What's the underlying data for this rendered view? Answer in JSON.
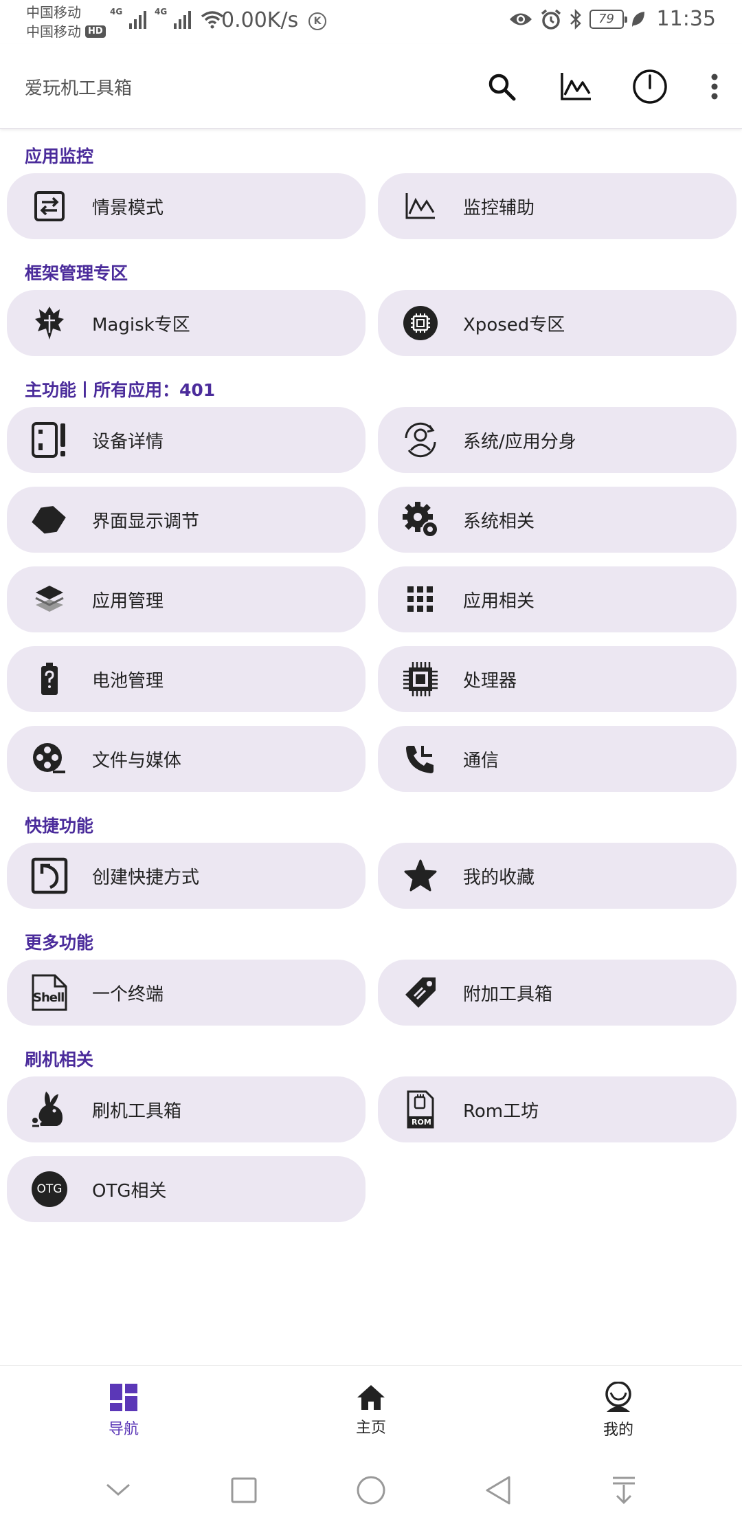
{
  "status": {
    "carrier1": "中国移动",
    "carrier2": "中国移动",
    "hd": "HD",
    "net1": "4G",
    "net2": "4G",
    "speed": "0.00K/s",
    "k_badge": "K",
    "battery": "79",
    "time": "11:35"
  },
  "appbar": {
    "title": "爱玩机工具箱",
    "icons": [
      "search-icon",
      "chart-icon",
      "power-icon",
      "more-vert-icon"
    ]
  },
  "sections": {
    "monitor": "应用监控",
    "framework": "框架管理专区",
    "main": "主功能丨所有应用：401",
    "quick": "快捷功能",
    "more": "更多功能",
    "flash": "刷机相关"
  },
  "tiles": {
    "scene_mode": "情景模式",
    "monitor_assist": "监控辅助",
    "magisk": "Magisk专区",
    "xposed": "Xposed专区",
    "device_info": "设备详情",
    "clone": "系统/应用分身",
    "display": "界面显示调节",
    "system": "系统相关",
    "app_manage": "应用管理",
    "app_related": "应用相关",
    "battery": "电池管理",
    "cpu": "处理器",
    "files_media": "文件与媒体",
    "comm": "通信",
    "shortcut": "创建快捷方式",
    "favorites": "我的收藏",
    "terminal": "一个终端",
    "extra_tools": "附加工具箱",
    "flash_tools": "刷机工具箱",
    "rom_workshop": "Rom工坊",
    "otg": "OTG相关",
    "otg_icon_text": "OTG",
    "shell_icon_text": "Shell",
    "rom_icon_text": "ROM"
  },
  "bottom_nav": {
    "nav": "导航",
    "home": "主页",
    "mine": "我的"
  },
  "colors": {
    "accent": "#5b37b7",
    "section_title": "#4b2c9b",
    "tile_bg": "#ece7f2"
  }
}
